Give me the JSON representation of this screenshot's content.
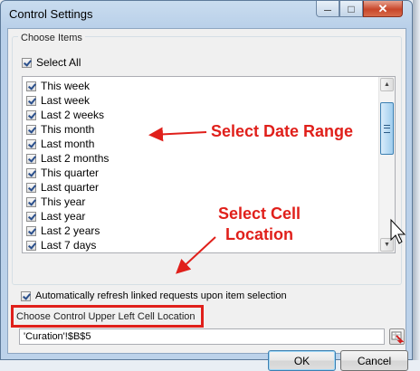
{
  "window": {
    "title": "Control Settings"
  },
  "caption_buttons": {
    "minimize": "—",
    "maximize": "□",
    "close": "✕"
  },
  "choose_items": {
    "label": "Choose Items",
    "select_all": {
      "label": "Select All",
      "checked": true
    },
    "items": [
      {
        "label": "This week",
        "checked": true
      },
      {
        "label": "Last week",
        "checked": true
      },
      {
        "label": "Last 2 weeks",
        "checked": true
      },
      {
        "label": "This month",
        "checked": true
      },
      {
        "label": "Last month",
        "checked": true
      },
      {
        "label": "Last 2 months",
        "checked": true
      },
      {
        "label": "This quarter",
        "checked": true
      },
      {
        "label": "Last quarter",
        "checked": true
      },
      {
        "label": "This year",
        "checked": true
      },
      {
        "label": "Last year",
        "checked": true
      },
      {
        "label": "Last 2 years",
        "checked": true
      },
      {
        "label": "Last 7 days",
        "checked": true
      }
    ]
  },
  "auto_refresh": {
    "label": "Automatically refresh linked requests upon item selection",
    "checked": true
  },
  "cell_location": {
    "label": "Choose Control Upper Left Cell Location",
    "value": "'Curation'!$B$5"
  },
  "buttons": {
    "ok": "OK",
    "cancel": "Cancel"
  },
  "annotations": {
    "date_range": "Select Date Range",
    "cell_line1": "Select Cell",
    "cell_line2": "Location",
    "color": "#e0201b"
  }
}
